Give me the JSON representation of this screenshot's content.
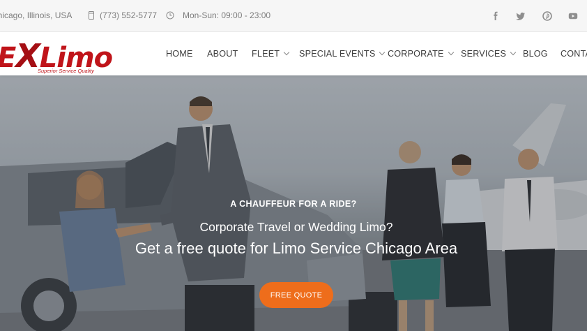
{
  "topbar": {
    "location": "Chicago, Illinois, USA",
    "phone": "(773) 552-5777",
    "hours": "Mon-Sun: 09:00 - 23:00",
    "social_icons": [
      "facebook-icon",
      "twitter-icon",
      "pinterest-icon",
      "youtube-icon"
    ]
  },
  "logo": {
    "prefix": "E",
    "x": "X",
    "suffix": "Limo",
    "tagline": "Superior Service Quality"
  },
  "nav": {
    "items": [
      {
        "label": "HOME",
        "has_dropdown": false
      },
      {
        "label": "ABOUT",
        "has_dropdown": false
      },
      {
        "label": "FLEET",
        "has_dropdown": true
      },
      {
        "label": "SPECIAL EVENTS",
        "has_dropdown": true
      },
      {
        "label": "CORPORATE",
        "has_dropdown": true
      },
      {
        "label": "SERVICES",
        "has_dropdown": true
      },
      {
        "label": "BLOG",
        "has_dropdown": false
      },
      {
        "label": "CONTA",
        "has_dropdown": false
      }
    ]
  },
  "hero": {
    "kicker": "A CHAUFFEUR FOR A RIDE?",
    "subtitle": "Corporate Travel or Wedding Limo?",
    "title": "Get a free quote for Limo Service Chicago Area",
    "button_label": "FREE QUOTE"
  },
  "colors": {
    "brand_red": "#c0141a",
    "accent_orange": "#ee6d1b",
    "topbar_bg": "#f6f6f6",
    "nav_text": "#3c3c3c"
  }
}
